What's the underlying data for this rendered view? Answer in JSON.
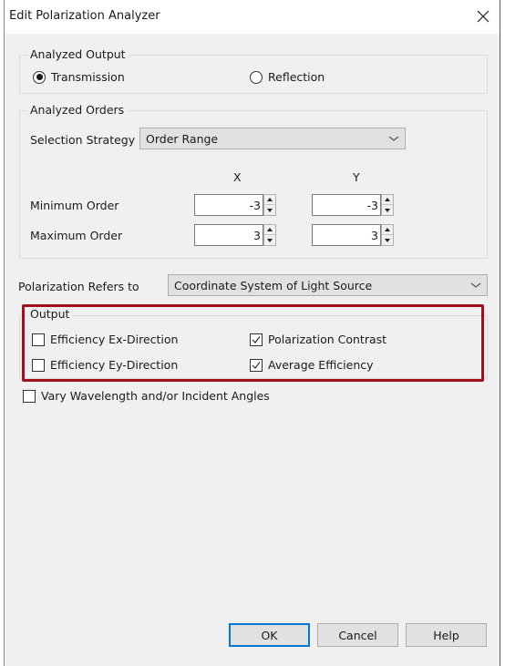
{
  "window": {
    "title": "Edit Polarization Analyzer",
    "close_icon": "close-icon"
  },
  "analyzed_output": {
    "label": "Analyzed Output",
    "options": [
      {
        "label": "Transmission",
        "selected": true
      },
      {
        "label": "Reflection",
        "selected": false
      }
    ]
  },
  "analyzed_orders": {
    "label": "Analyzed Orders",
    "selection_strategy_label": "Selection Strategy",
    "selection_strategy_value": "Order Range",
    "col_x": "X",
    "col_y": "Y",
    "min_order_label": "Minimum Order",
    "max_order_label": "Maximum Order",
    "min_x": "-3",
    "min_y": "-3",
    "max_x": "3",
    "max_y": "3"
  },
  "polarization": {
    "label": "Polarization Refers to",
    "value": "Coordinate System of Light Source"
  },
  "output": {
    "label": "Output",
    "checkboxes": [
      {
        "label": "Efficiency Ex-Direction",
        "checked": false
      },
      {
        "label": "Polarization Contrast",
        "checked": true
      },
      {
        "label": "Efficiency Ey-Direction",
        "checked": false
      },
      {
        "label": "Average Efficiency",
        "checked": true
      }
    ],
    "highlight_color": "#a3101c"
  },
  "vary": {
    "label": "Vary Wavelength and/or Incident Angles",
    "checked": false
  },
  "buttons": {
    "ok": "OK",
    "cancel": "Cancel",
    "help": "Help"
  }
}
